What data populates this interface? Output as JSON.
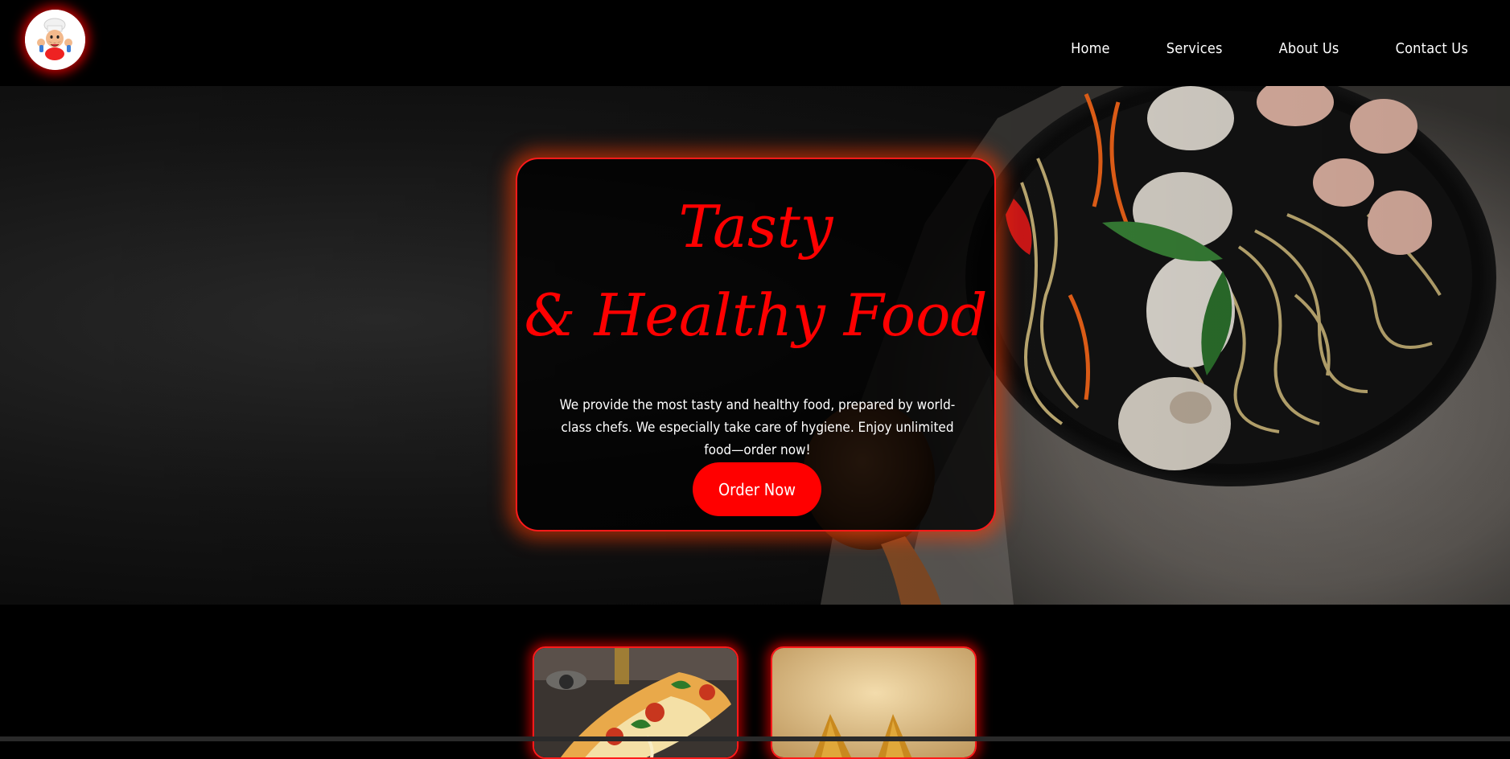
{
  "logo": {
    "icon": "chef-mascot-icon"
  },
  "nav": {
    "items": [
      {
        "label": "Home"
      },
      {
        "label": "Services"
      },
      {
        "label": "About Us"
      },
      {
        "label": "Contact Us"
      }
    ]
  },
  "hero": {
    "title_line1": "Tasty",
    "title_line2": "& Healthy Food",
    "description": "We provide the most tasty and healthy food, prepared by world-class chefs. We especially take care of hygiene. Enjoy unlimited food—order now!",
    "button_label": "Order Now",
    "background_image": "noodle-bowl-with-shrimp-and-mushrooms"
  },
  "cards": [
    {
      "image": "pizza-slice-photo"
    },
    {
      "image": "samosa-photo"
    }
  ],
  "colors": {
    "accent": "#ff0000",
    "background": "#000000",
    "text": "#ffffff"
  }
}
